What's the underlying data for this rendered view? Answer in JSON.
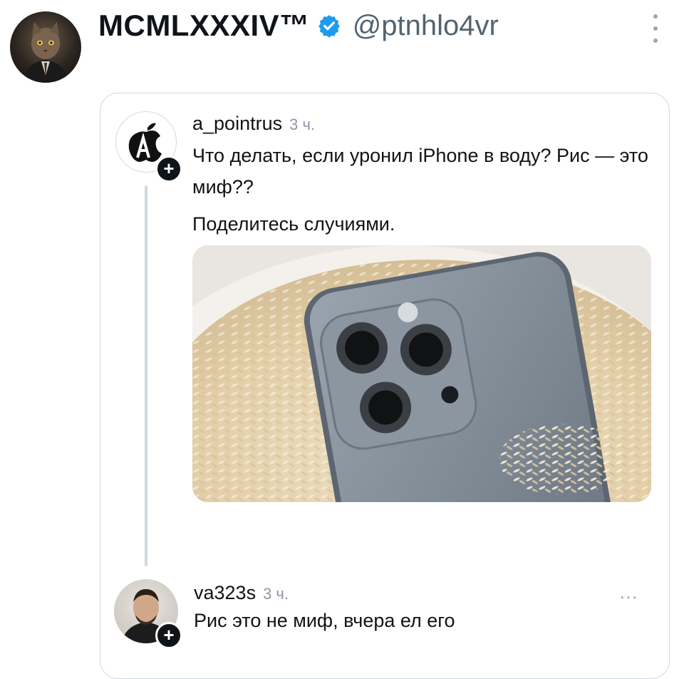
{
  "author": {
    "name": "MCMLXXXIV™",
    "handle": "@ptnhlo4vr"
  },
  "colors": {
    "verified": "#1d9bf0",
    "muted": "#8b98a5",
    "border": "#cfd9de"
  },
  "icons": {
    "verified": "verified-badge-icon",
    "more": "more-vertical-icon",
    "plus": "plus-icon",
    "apple": "apple-logo-icon"
  },
  "post": {
    "username": "a_pointrus",
    "time": "3 ч.",
    "line1": "Что делать, если уронил iPhone в воду? Рис — это миф??",
    "line2": "Поделитесь случиями.",
    "plus": "+"
  },
  "reply": {
    "username": "va323s",
    "time": "3 ч.",
    "more": "...",
    "text": "Рис это не миф, вчера ел его",
    "plus": "+"
  }
}
